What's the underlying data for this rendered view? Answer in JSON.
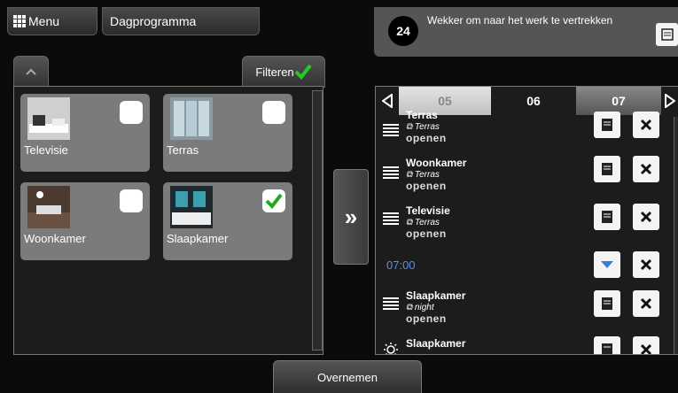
{
  "header": {
    "menu_label": "Menu",
    "title": "Dagprogramma",
    "clock_label": "24",
    "alarm_text": "Wekker om naar het werk te vertrekken"
  },
  "left": {
    "filter_label": "Filteren",
    "tiles": [
      {
        "label": "Televisie",
        "checked": false
      },
      {
        "label": "Terras",
        "checked": false
      },
      {
        "label": "Woonkamer",
        "checked": false
      },
      {
        "label": "Slaapkamer",
        "checked": true
      }
    ]
  },
  "transfer": {
    "arrow": "»"
  },
  "schedule": {
    "days": [
      "05",
      "06",
      "07"
    ],
    "rows": [
      {
        "room": "Terras",
        "sub": "Terras",
        "action": "openen"
      },
      {
        "room": "Woonkamer",
        "sub": "Terras",
        "action": "openen"
      },
      {
        "room": "Televisie",
        "sub": "Terras",
        "action": "openen"
      },
      {
        "room": "Slaapkamer",
        "sub": "night",
        "action": "openen"
      },
      {
        "room": "Slaapkamer",
        "sub": "",
        "action": ""
      }
    ],
    "time": "07:00"
  },
  "footer": {
    "confirm_label": "Overnemen"
  },
  "colors": {
    "accent_blue": "#3a7bd5",
    "check_green": "#22aa22"
  }
}
